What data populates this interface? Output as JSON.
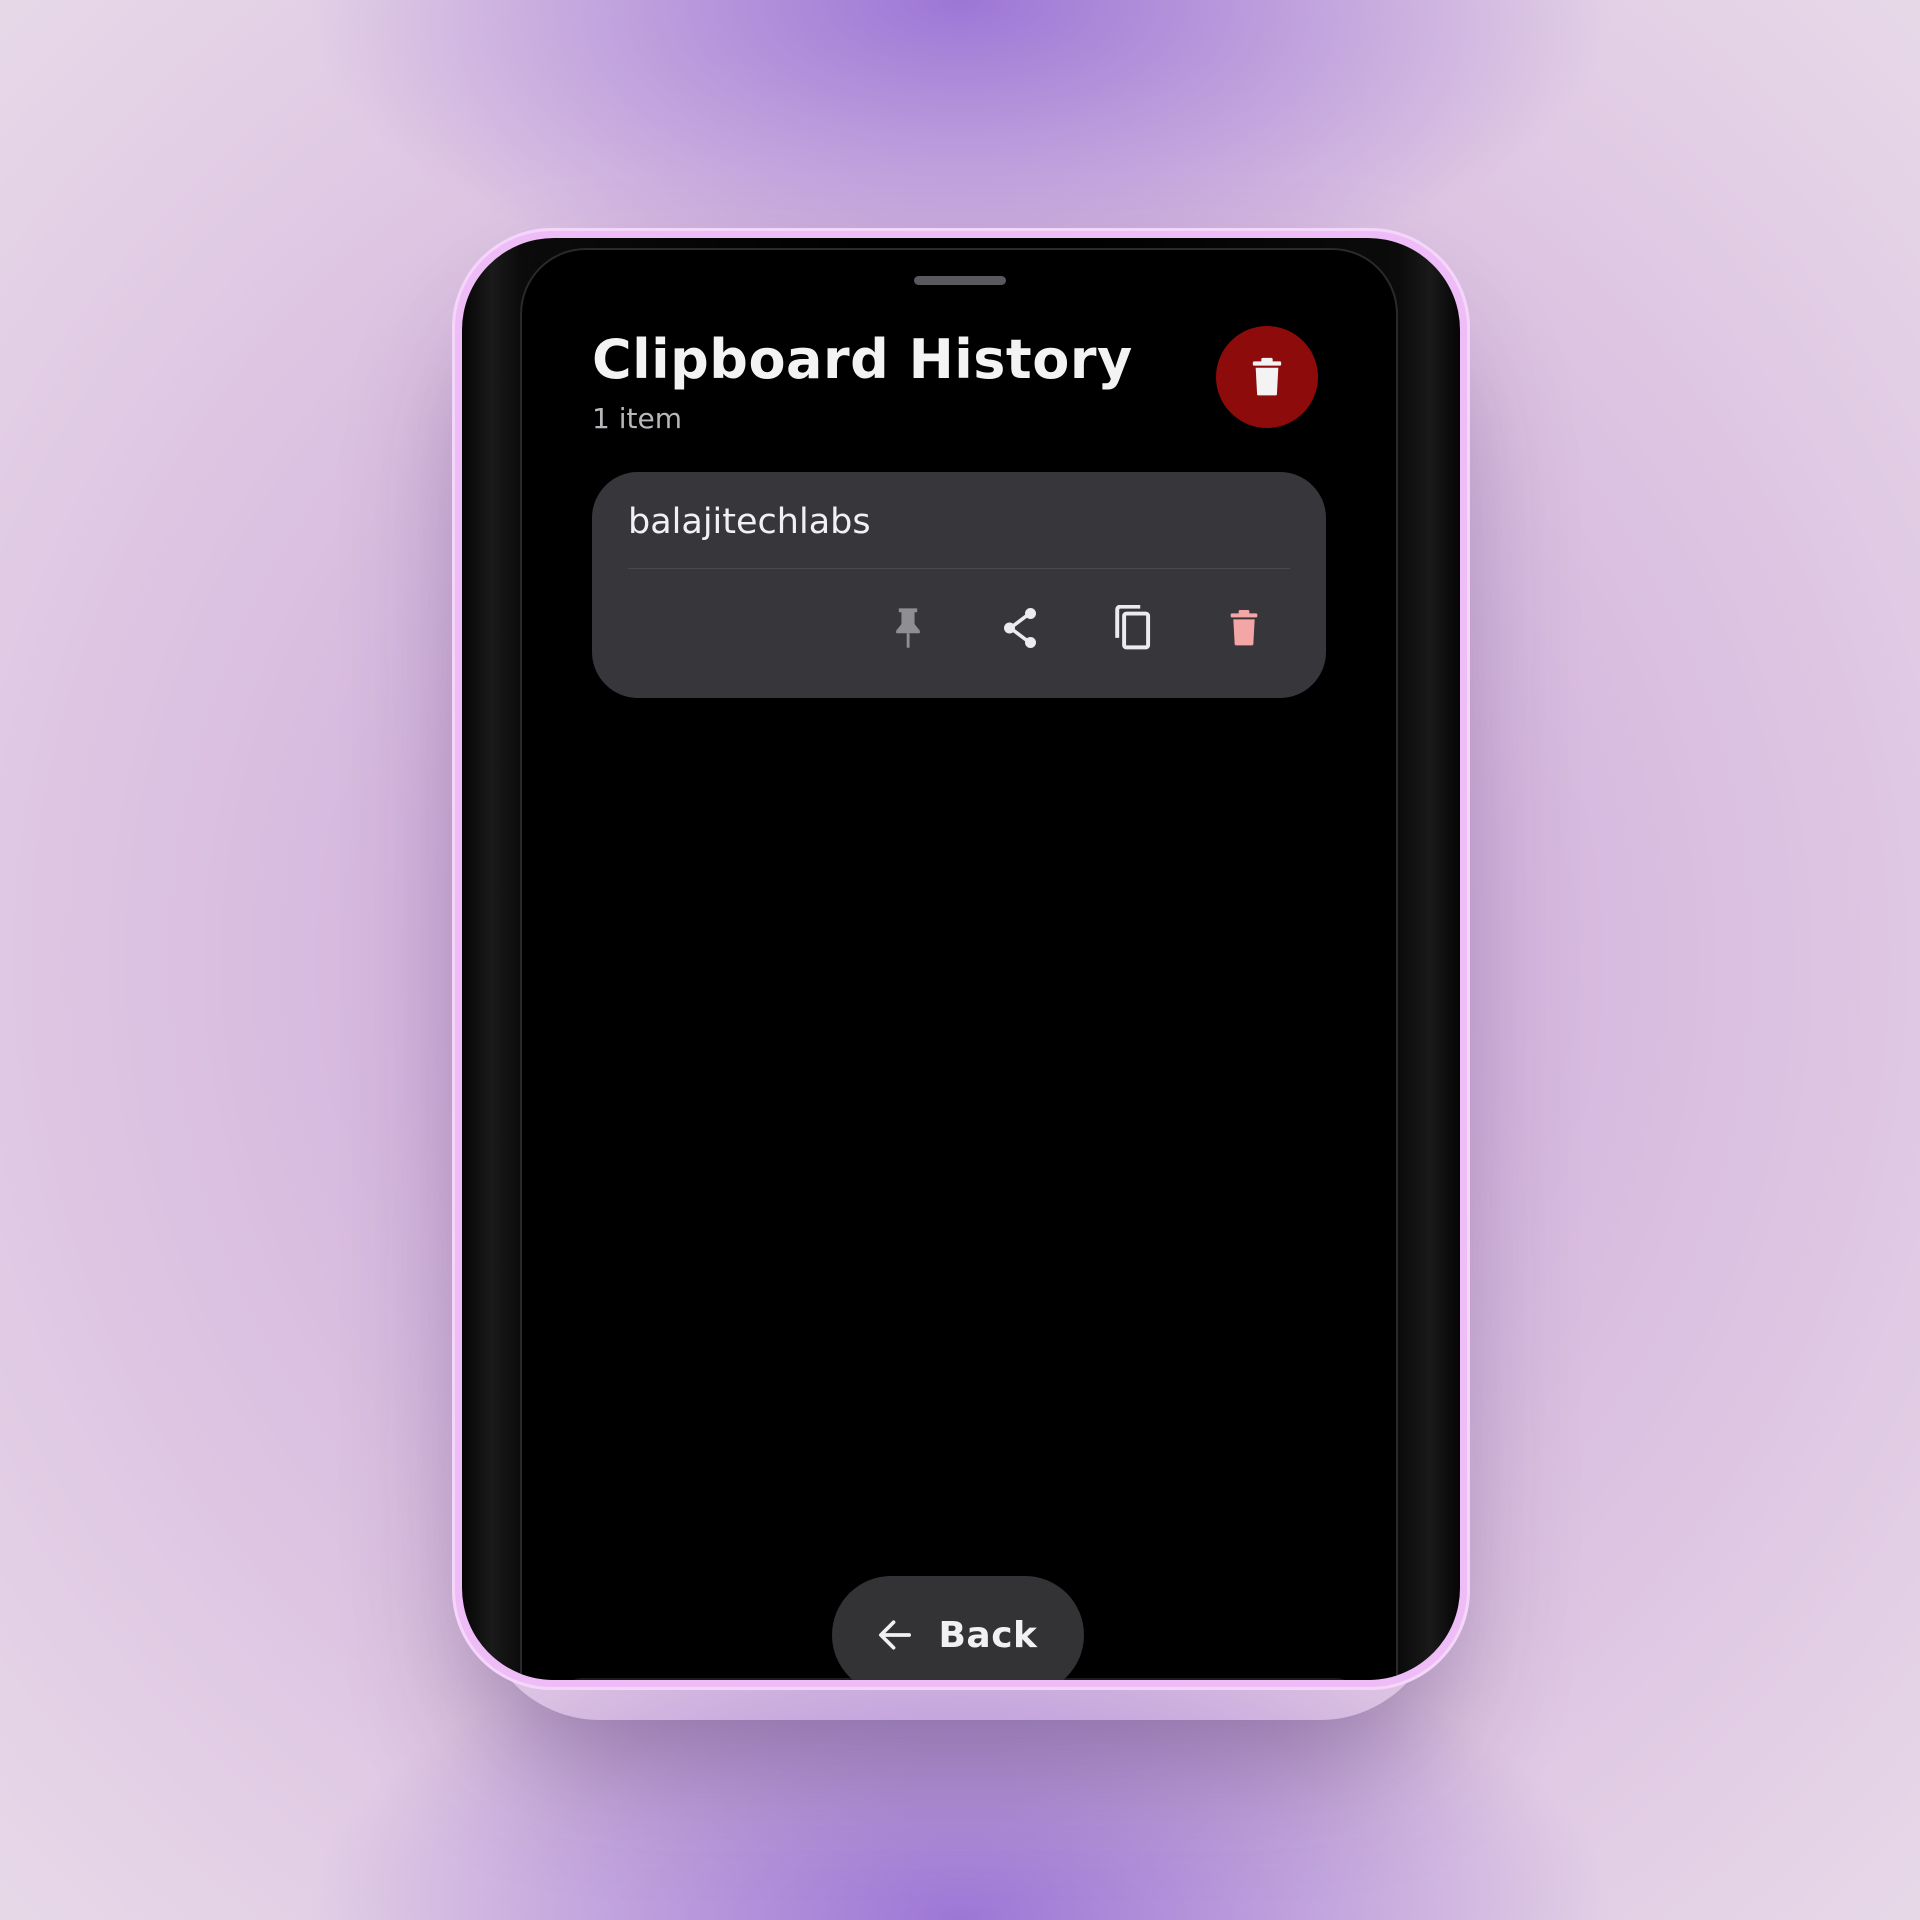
{
  "header": {
    "title": "Clipboard History",
    "item_count": "1 item"
  },
  "clear_all": {
    "icon": "trash-icon",
    "color": "#8d0b0b"
  },
  "items": [
    {
      "text": "balajitechlabs",
      "actions": [
        {
          "name": "pin",
          "icon": "pin-icon",
          "color": "#8e8e93"
        },
        {
          "name": "share",
          "icon": "share-icon",
          "color": "#ececf0"
        },
        {
          "name": "copy",
          "icon": "copy-icon",
          "color": "#ececf0"
        },
        {
          "name": "delete",
          "icon": "trash-icon",
          "color": "#f4a6a6"
        }
      ]
    }
  ],
  "footer": {
    "back_label": "Back",
    "back_icon": "arrow-left-icon"
  },
  "colors": {
    "background": "#000000",
    "card": "#37373b",
    "device_frame": "#eebcf6"
  }
}
